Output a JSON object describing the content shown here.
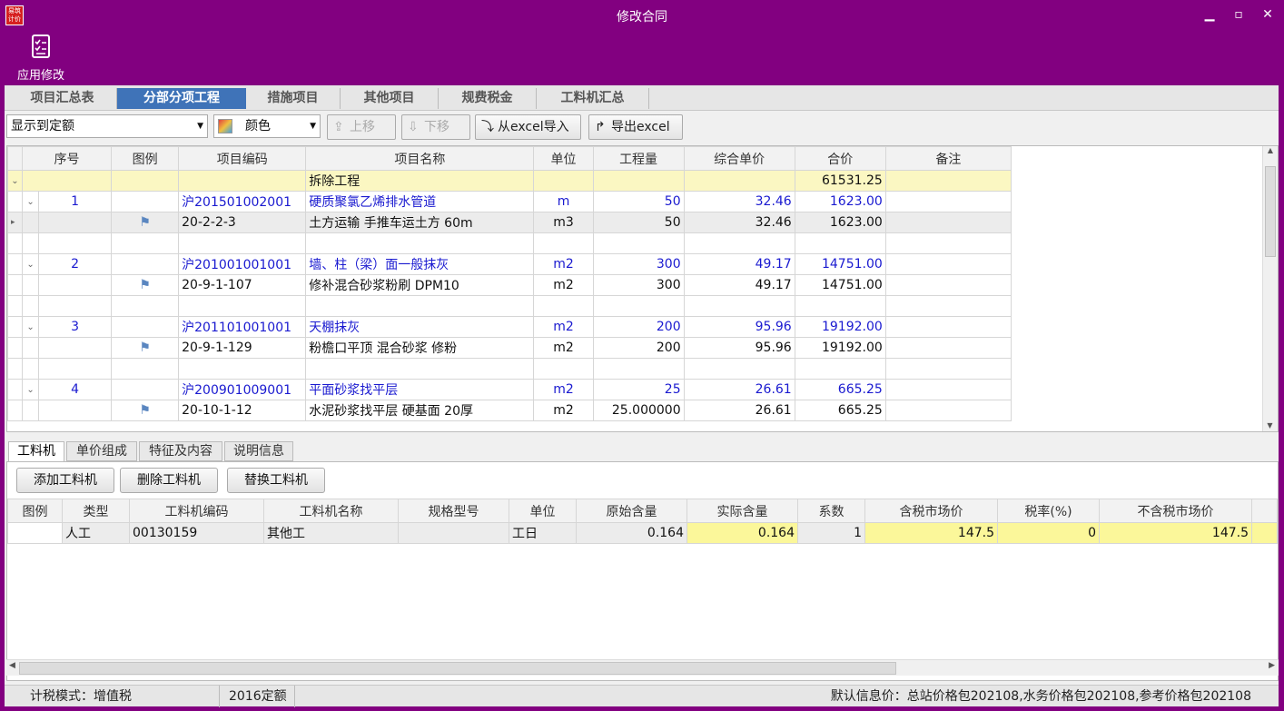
{
  "window": {
    "title": "修改合同",
    "app_icon": "易筑计价"
  },
  "ribbon": {
    "apply_label": "应用修改"
  },
  "tabs": [
    "项目汇总表",
    "分部分项工程",
    "措施项目",
    "其他项目",
    "规费税金",
    "工料机汇总"
  ],
  "toolbar": {
    "display_select": "显示到定额",
    "color_select": "颜色",
    "up": "上移",
    "down": "下移",
    "import": "从excel导入",
    "export": "导出excel"
  },
  "grid": {
    "headers": [
      "序号",
      "图例",
      "项目编码",
      "项目名称",
      "单位",
      "工程量",
      "综合单价",
      "合价",
      "备注"
    ],
    "rows": [
      {
        "kind": "section",
        "name": "拆除工程",
        "total": "61531.25"
      },
      {
        "kind": "item",
        "seq": "1",
        "code": "沪201501002001",
        "name": "硬质聚氯乙烯排水管道",
        "unit": "m",
        "qty": "50",
        "price": "32.46",
        "total": "1623.00"
      },
      {
        "kind": "quota",
        "code": "20-2-2-3",
        "name": "土方运输 手推车运土方 60m",
        "unit": "m3",
        "qty": "50",
        "price": "32.46",
        "total": "1623.00"
      },
      {
        "kind": "blank"
      },
      {
        "kind": "item",
        "seq": "2",
        "code": "沪201001001001",
        "name": "墙、柱（梁）面一般抹灰",
        "unit": "m2",
        "qty": "300",
        "price": "49.17",
        "total": "14751.00"
      },
      {
        "kind": "quota",
        "code": "20-9-1-107",
        "name": "修补混合砂浆粉刷 DPM10",
        "unit": "m2",
        "qty": "300",
        "price": "49.17",
        "total": "14751.00"
      },
      {
        "kind": "blank"
      },
      {
        "kind": "item",
        "seq": "3",
        "code": "沪201101001001",
        "name": "天棚抹灰",
        "unit": "m2",
        "qty": "200",
        "price": "95.96",
        "total": "19192.00"
      },
      {
        "kind": "quota",
        "code": "20-9-1-129",
        "name": "粉檐口平顶 混合砂浆 修粉",
        "unit": "m2",
        "qty": "200",
        "price": "95.96",
        "total": "19192.00"
      },
      {
        "kind": "blank"
      },
      {
        "kind": "item",
        "seq": "4",
        "code": "沪200901009001",
        "name": "平面砂浆找平层",
        "unit": "m2",
        "qty": "25",
        "price": "26.61",
        "total": "665.25"
      },
      {
        "kind": "quota",
        "code": "20-10-1-12",
        "name": "水泥砂浆找平层 硬基面 20厚",
        "unit": "m2",
        "qty": "25.000000",
        "price": "26.61",
        "total": "665.25"
      }
    ]
  },
  "lower_tabs": [
    "工料机",
    "单价组成",
    "特征及内容",
    "说明信息"
  ],
  "lower_buttons": [
    "添加工料机",
    "删除工料机",
    "替换工料机"
  ],
  "res_grid": {
    "headers": [
      "图例",
      "类型",
      "工料机编码",
      "工料机名称",
      "规格型号",
      "单位",
      "原始含量",
      "实际含量",
      "系数",
      "含税市场价",
      "税率(%)",
      "不含税市场价"
    ],
    "row": {
      "type": "人工",
      "code": "00130159",
      "name": "其他工",
      "spec": "",
      "unit": "工日",
      "orig": "0.164",
      "actual": "0.164",
      "coef": "1",
      "price_tax": "147.5",
      "tax": "0",
      "price_notax": "147.5"
    }
  },
  "status": {
    "tax_mode": "计税模式：增值税",
    "quota": "2016定额",
    "info": "默认信息价：总站价格包202108,水务价格包202108,参考价格包202108"
  }
}
